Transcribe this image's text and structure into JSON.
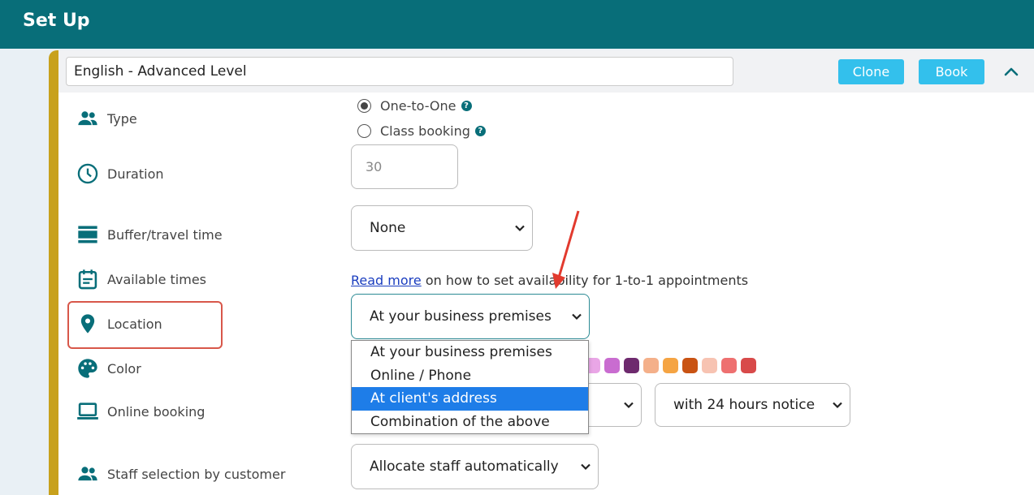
{
  "header": {
    "title": "Set Up",
    "bg_color": "#086e79"
  },
  "service": {
    "name": "English - Advanced Level",
    "clone_label": "Clone",
    "book_label": "Book",
    "accent_color": "#c8a11c"
  },
  "rows": {
    "type": {
      "label": "Type",
      "icon": "people-icon"
    },
    "duration": {
      "label": "Duration",
      "icon": "clock-icon"
    },
    "buffer": {
      "label": "Buffer/travel time",
      "icon": "buffer-icon"
    },
    "available": {
      "label": "Available times",
      "icon": "calendar-icon"
    },
    "location": {
      "label": "Location",
      "icon": "location-pin-icon"
    },
    "color": {
      "label": "Color",
      "icon": "palette-icon"
    },
    "online": {
      "label": "Online booking",
      "icon": "laptop-icon"
    },
    "staff": {
      "label": "Staff selection by customer",
      "icon": "people-icon"
    }
  },
  "type_options": [
    {
      "label": "One-to-One",
      "checked": true
    },
    {
      "label": "Class booking",
      "checked": false
    }
  ],
  "duration_value": "30",
  "buffer_value": "None",
  "available_text": {
    "link": "Read more",
    "rest": " on how to set availability for 1-to-1 appointments"
  },
  "location": {
    "value": "At your business premises",
    "options": [
      "At your business premises",
      "Online / Phone",
      "At client's address",
      "Combination of the above"
    ],
    "highlighted_index": 2
  },
  "colors": [
    "#e9a6e6",
    "#c96cd0",
    "#6e2a6e",
    "#f4b08a",
    "#f5a443",
    "#c95313",
    "#f7c3b2",
    "#ee7070",
    "#d84a4a"
  ],
  "online_booking": {
    "notice": "with 24 hours notice"
  },
  "staff_value": "Allocate staff automatically"
}
